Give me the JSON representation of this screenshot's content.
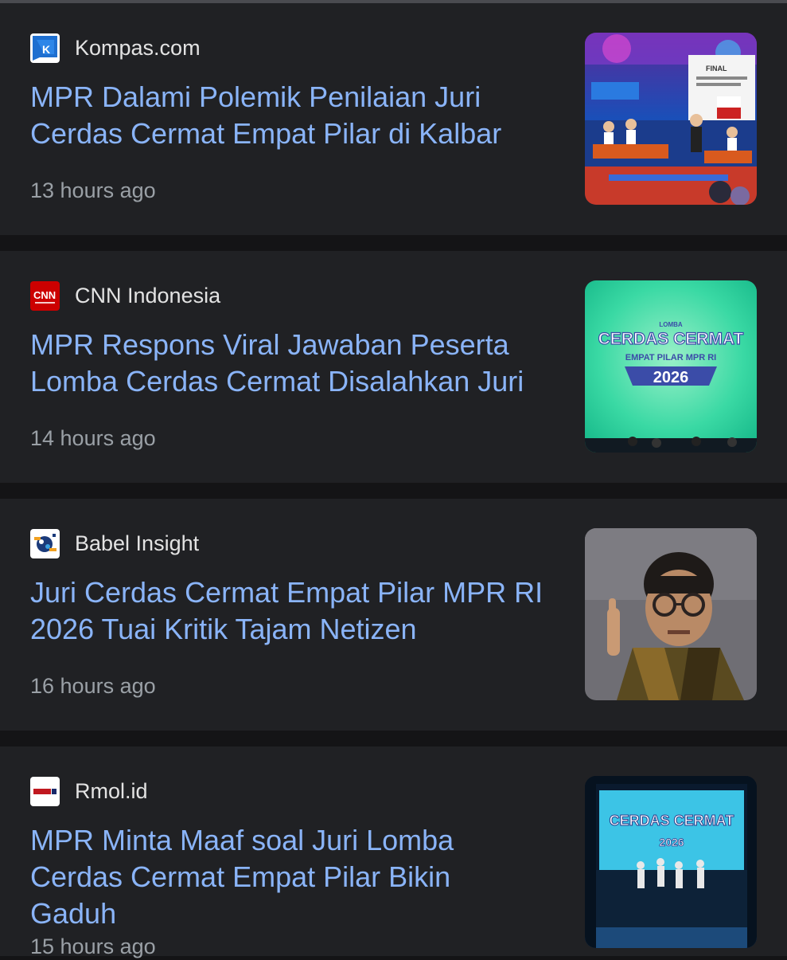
{
  "articles": [
    {
      "source": "Kompas.com",
      "source_logo_icon": "kompas-logo-icon",
      "headline": "MPR Dalami Polemik Penilaian Juri Cerdas Cermat Empat Pilar di Kalbar",
      "time": "13 hours ago",
      "thumbnail": "stage-event-illustration",
      "thumb_text": [
        "FINAL"
      ]
    },
    {
      "source": "CNN Indonesia",
      "source_logo_icon": "cnn-logo-icon",
      "headline": "MPR Respons Viral Jawaban Peserta Lomba Cerdas Cermat Disalahkan Juri",
      "time": "14 hours ago",
      "thumbnail": "cerdas-cermat-banner",
      "thumb_text": [
        "LOMBA",
        "CERDAS CERMAT",
        "EMPAT PILAR MPR RI",
        "2026"
      ]
    },
    {
      "source": "Babel Insight",
      "source_logo_icon": "babel-insight-logo-icon",
      "headline": "Juri Cerdas Cermat Empat Pilar MPR RI 2026 Tuai Kritik Tajam Netizen",
      "time": "16 hours ago",
      "thumbnail": "jury-member-photo"
    },
    {
      "source": "Rmol.id",
      "source_logo_icon": "rmol-logo-icon",
      "headline": "MPR Minta Maaf soal Juri Lomba Cerdas Cermat Empat Pilar Bikin Gaduh",
      "time": "15 hours ago",
      "thumbnail": "stage-screen-photo",
      "thumb_text": [
        "CERDAS CERMAT",
        "2026"
      ]
    }
  ],
  "colors": {
    "background": "#141416",
    "card": "#202124",
    "headline": "#8ab4f8",
    "source": "#e3e3e3",
    "time": "#9aa0a6"
  }
}
